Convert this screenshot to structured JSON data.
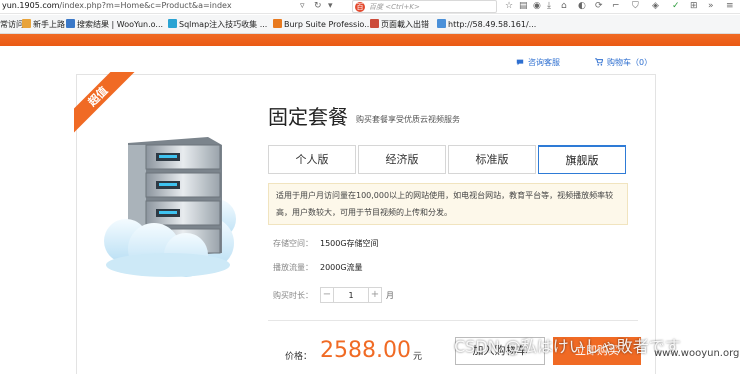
{
  "browser": {
    "url_domain": "yun.1905.com",
    "url_path": "/index.php?m=Home&c=Product&a=index",
    "search_placeholder": "百度 <Ctrl+K>",
    "bookmarks": [
      {
        "label": "常访问",
        "color": "#4a90d9"
      },
      {
        "label": "新手上路",
        "color": "#e8a33b"
      },
      {
        "label": "搜索结果 | WooYun.o...",
        "color": "#3a78c8"
      },
      {
        "label": "Sqlmap注入技巧收集 ...",
        "color": "#2aa3d3"
      },
      {
        "label": "Burp Suite Professio...",
        "color": "#e8791e"
      },
      {
        "label": "页面載入出错",
        "color": "#cc4b3a"
      },
      {
        "label": "http://58.49.58.161/...",
        "color": "#4a90d9"
      }
    ]
  },
  "header": {
    "consult": "咨询客服",
    "cart": "购物车（0）"
  },
  "product": {
    "badge": "超值",
    "title": "固定套餐",
    "subtitle": "购买套餐享受优质云视频服务",
    "tabs": [
      {
        "label": "个人版",
        "active": false
      },
      {
        "label": "经济版",
        "active": false
      },
      {
        "label": "标准版",
        "active": false
      },
      {
        "label": "旗舰版",
        "active": true
      }
    ],
    "description_line1": "适用于用户月访问量在100,000以上的网站使用，如电视台网站，教育平台等，视频播放频率较",
    "description_line2": "高，用户数较大，可用于节目视频的上传和分发。",
    "storage_label": "存储空间：",
    "storage_value": "1500G存储空间",
    "traffic_label": "播放流量：",
    "traffic_value": "2000G流量",
    "duration_label": "购买时长：",
    "quantity": "1",
    "duration_unit": "月",
    "price_label": "价格：",
    "price": "2588.00",
    "price_unit": "元",
    "add_to_cart": "加入购物车",
    "buy_now": "立即购买"
  },
  "overlay": {
    "csdn_watermark": "CSDN @私はけいしゃ敗者です",
    "site_watermark": "www.wooyun.org"
  },
  "colors": {
    "brand_orange": "#f06a24",
    "link_blue": "#2e6fd0",
    "tab_active_border": "#2e7bd6"
  }
}
